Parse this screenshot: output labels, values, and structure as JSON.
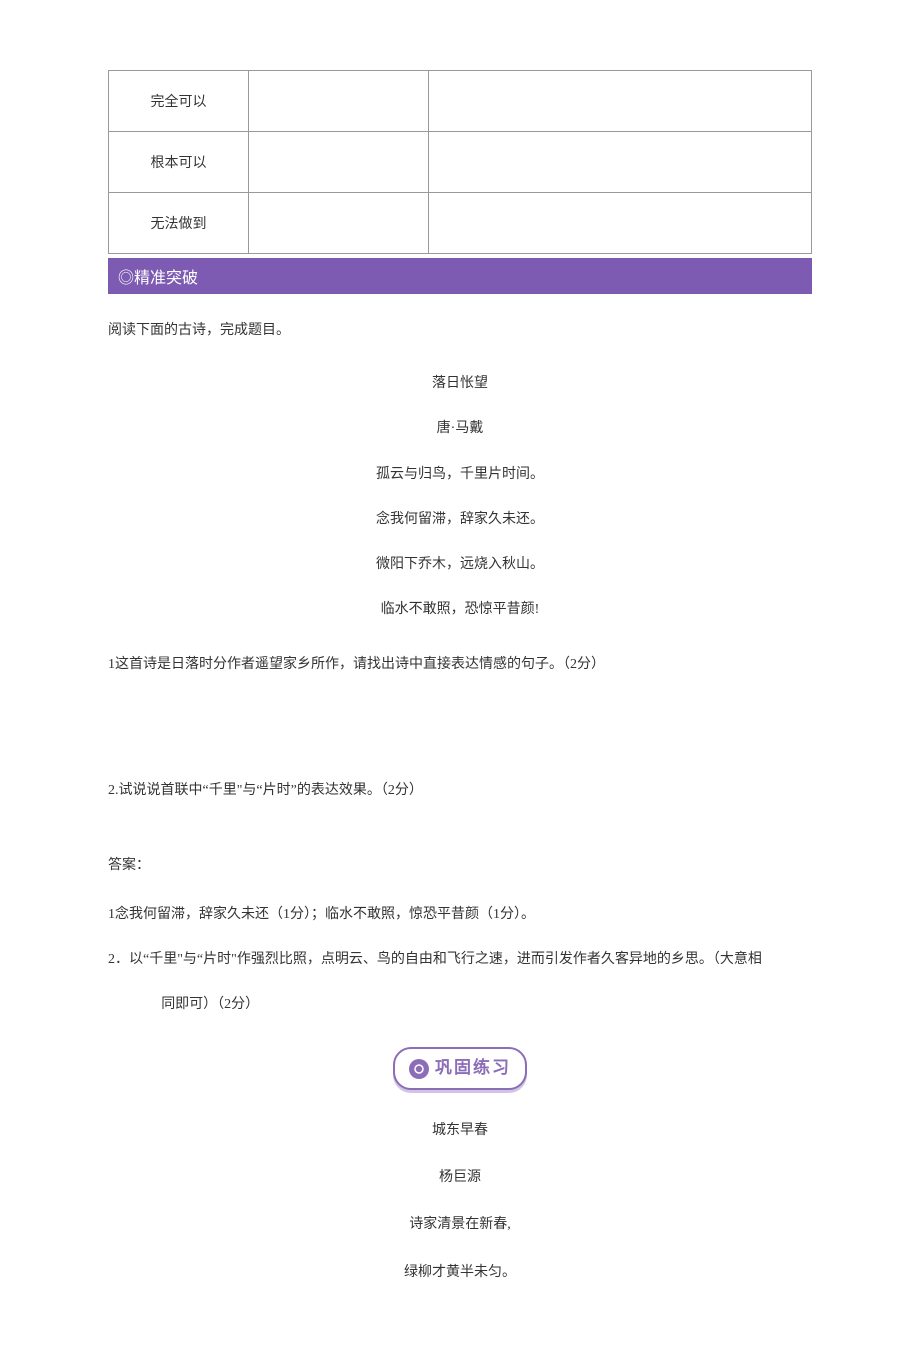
{
  "checklist": {
    "rows": [
      {
        "label": "完全可以"
      },
      {
        "label": "根本可以"
      },
      {
        "label": "无法做到"
      }
    ]
  },
  "section_banner": "◎精准突破",
  "instruction": "阅读下面的古诗，完成题目。",
  "poem1": {
    "title": "落日怅望",
    "author": "唐·马戴",
    "lines": [
      "孤云与归鸟，千里片时间。",
      "念我何留滞，辞家久未还。",
      "微阳下乔木，远烧入秋山。",
      "临水不敢照，恐惊平昔颜!"
    ]
  },
  "questions": {
    "q1": "1这首诗是日落时分作者遥望家乡所作，请找出诗中直接表达情感的句子。（2分）",
    "q2": "2.试说说首联中“千里\"与“片时”的表达效果。（2分）"
  },
  "answers": {
    "header": "答案：",
    "a1": "1念我何留滞，辞家久未还（1分）；临水不敢照，惊恐平昔颜（1分）。",
    "a2_line1": "2．以“千里\"与“片时\"作强烈比照，点明云、鸟的自由和飞行之速，进而引发作者久客异地的乡思。（大意相",
    "a2_line2": "同即可）（2分）"
  },
  "practice_badge": "巩固练习",
  "poem2": {
    "title": "城东早春",
    "author": "杨巨源",
    "lines": [
      "诗家清景在新春,",
      "绿柳才黄半未匀。"
    ]
  }
}
